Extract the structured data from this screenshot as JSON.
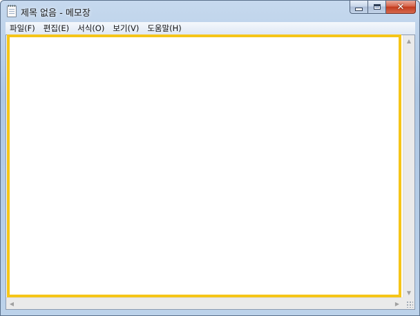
{
  "window": {
    "title": "제목 없음 - 메모장",
    "icon": "notepad-icon",
    "controls": {
      "minimize": "minimize-icon",
      "maximize": "maximize-icon",
      "close": "close-icon",
      "close_glyph": "✕"
    }
  },
  "menu": {
    "items": [
      "파일(F)",
      "편집(E)",
      "서식(O)",
      "보기(V)",
      "도움말(H)"
    ]
  },
  "editor": {
    "content": "",
    "highlight_color": "#f5c518"
  },
  "scrollbars": {
    "up_arrow": "▲",
    "down_arrow": "▼",
    "left_arrow": "◀",
    "right_arrow": "▶"
  }
}
